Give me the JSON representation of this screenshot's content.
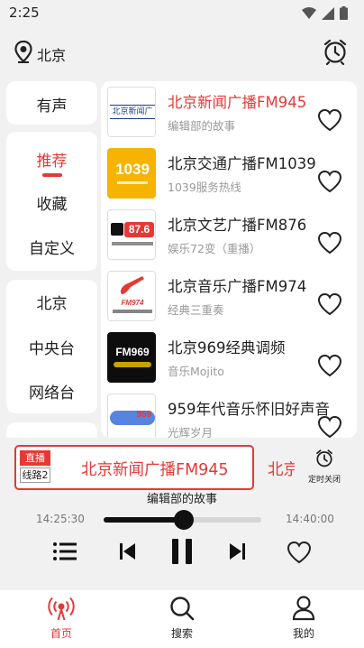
{
  "status_bar": {
    "time": "2:25"
  },
  "header": {
    "location": "北京"
  },
  "categories": {
    "group1": [
      "有声"
    ],
    "group2": [
      "推荐",
      "收藏",
      "自定义"
    ],
    "group3": [
      "北京",
      "中央台",
      "网络台"
    ]
  },
  "stations": [
    {
      "name": "北京新闻广播FM945",
      "desc": "编辑部的故事",
      "playing": true,
      "logo_text": "北京新闻广"
    },
    {
      "name": "北京交通广播FM1039",
      "desc": "1039服务热线",
      "playing": false,
      "logo_text": "1039"
    },
    {
      "name": "北京文艺广播FM876",
      "desc": "娱乐72变（重播）",
      "playing": false,
      "logo_text": "87.6"
    },
    {
      "name": "北京音乐广播FM974",
      "desc": "经典三重奏",
      "playing": false,
      "logo_text": "FM974"
    },
    {
      "name": "北京969经典调频",
      "desc": "音乐Mojito",
      "playing": false,
      "logo_text": "FM969"
    },
    {
      "name": "959年代音乐怀旧好声音",
      "desc": "光辉岁月",
      "playing": false,
      "logo_text": "959"
    }
  ],
  "player": {
    "live_label": "直播",
    "line_label": "线路2",
    "title": "北京新闻广播FM945",
    "marquee_next": "北京",
    "sleep_timer_label": "定时关闭",
    "program": "编辑部的故事",
    "start_time": "14:25:30",
    "end_time": "14:40:00",
    "progress": 0.51
  },
  "tabs": [
    {
      "label": "首页",
      "icon": "radio-waves-icon",
      "active": true
    },
    {
      "label": "搜索",
      "icon": "search-icon",
      "active": false
    },
    {
      "label": "我的",
      "icon": "user-icon",
      "active": false
    }
  ],
  "colors": {
    "accent": "#e53935",
    "background": "#f1f1f1"
  }
}
